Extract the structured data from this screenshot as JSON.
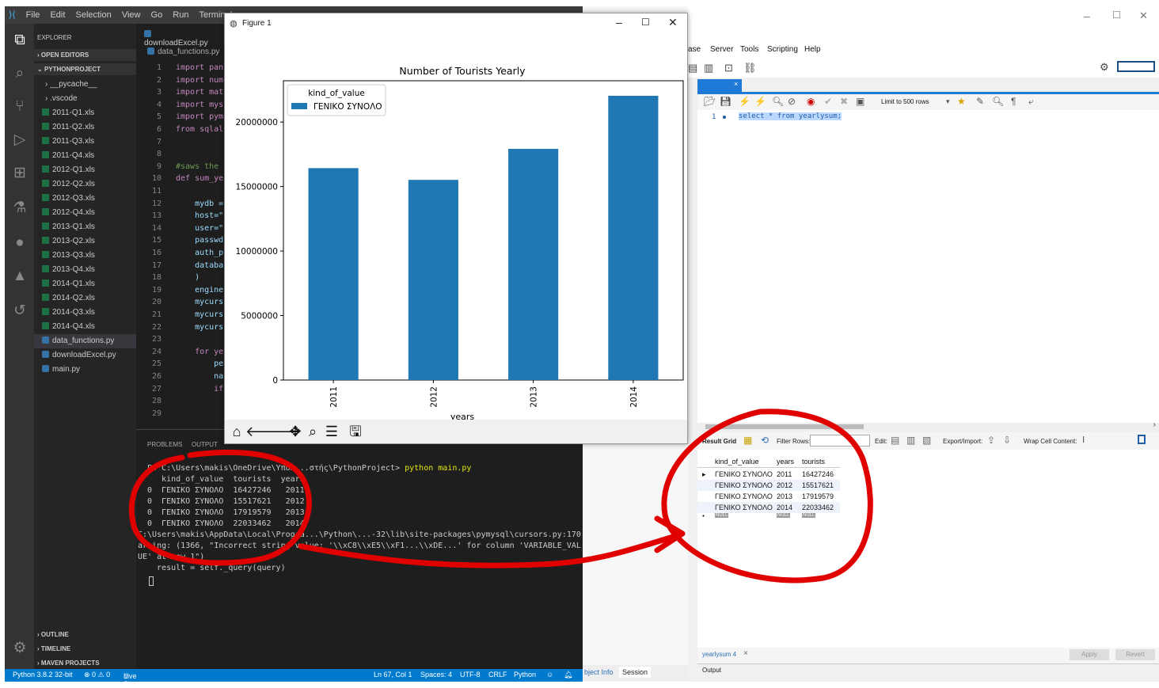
{
  "vscode": {
    "menu": [
      "File",
      "Edit",
      "Selection",
      "View",
      "Go",
      "Run",
      "Terminal"
    ],
    "explorer_title": "EXPLORER",
    "open_editors": "OPEN EDITORS",
    "project": "PYTHONPROJECT",
    "folders": [
      "__pycache__",
      ".vscode"
    ],
    "xls_files": [
      "2011-Q1.xls",
      "2011-Q2.xls",
      "2011-Q3.xls",
      "2011-Q4.xls",
      "2012-Q1.xls",
      "2012-Q2.xls",
      "2012-Q3.xls",
      "2012-Q4.xls",
      "2013-Q1.xls",
      "2013-Q2.xls",
      "2013-Q3.xls",
      "2013-Q4.xls",
      "2014-Q1.xls",
      "2014-Q2.xls",
      "2014-Q3.xls",
      "2014-Q4.xls"
    ],
    "py_files": [
      "data_functions.py",
      "downloadExcel.py",
      "main.py"
    ],
    "outline": "OUTLINE",
    "timeline": "TIMELINE",
    "maven": "MAVEN PROJECTS",
    "tab": "downloadExcel.py",
    "breadcrumb": "data_functions.py",
    "line_numbers": [
      "1",
      "2",
      "3",
      "4",
      "5",
      "6",
      "7",
      "8",
      "9",
      "10",
      "11",
      "12",
      "13",
      "14",
      "15",
      "16",
      "17",
      "18",
      "19",
      "20",
      "21",
      "22",
      "23",
      "24",
      "25",
      "26",
      "27",
      "28",
      "29"
    ],
    "code_lines": [
      "import pan",
      "import num",
      "import mat",
      "import mys",
      "import pym",
      "from sqlal",
      "",
      "",
      "#saws the",
      "def sum_ye",
      "",
      "    mydb =",
      "    host=\"",
      "    user=\"",
      "    passwd",
      "    auth_p",
      "    databa",
      "    )",
      "    engine",
      "    mycurs",
      "    mycurs",
      "    mycurs",
      "",
      "    for ye",
      "        pe",
      "        na",
      "        if",
      "",
      ""
    ],
    "panel_tabs": [
      "PROBLEMS",
      "OUTPUT"
    ],
    "terminal": [
      "PS C:\\Users\\makis\\OneDrive\\Υπολ...στής\\PythonProject> ",
      "   kind_of_value  tourists  years",
      "0  ΓΕΝΙΚΟ ΣΥΝΟΛΟ  16427246   2011",
      "0  ΓΕΝΙΚΟ ΣΥΝΟΛΟ  15517621   2012",
      "0  ΓΕΝΙΚΟ ΣΥΝΟΛΟ  17919579   2013",
      "0  ΓΕΝΙΚΟ ΣΥΝΟΛΟ  22033462   2014",
      "C:\\Users\\makis\\AppData\\Local\\Progra...\\Python\\...-32\\lib\\site-packages\\pymysql\\cursors.py:170: W",
      "arning: (1366, \"Incorrect string value: '\\\\xC8\\\\xE5\\\\xF1...\\\\xDE...' for column 'VARIABLE_VAL",
      "UE' at row 1\")",
      "  result = self._query(query)"
    ],
    "terminal_cmd": "python main.py",
    "status": {
      "python": "Python 3.8.2 32-bit",
      "problems": "⊗ 0 ⚠ 0",
      "liveshare": "Live Share",
      "pos": "Ln 67, Col 1",
      "spaces": "Spaces: 4",
      "enc": "UTF-8",
      "eol": "CRLF",
      "lang": "Python"
    }
  },
  "figure": {
    "window_title": "Figure 1"
  },
  "chart_data": {
    "type": "bar",
    "title": "Number of Tourists Yearly",
    "xlabel": "years",
    "ylabel": "",
    "categories": [
      "2011",
      "2012",
      "2013",
      "2014"
    ],
    "series": [
      {
        "name": "ΓΕΝΙΚΟ ΣΥΝΟΛΟ",
        "values": [
          16427246,
          15517621,
          17919579,
          22033462
        ]
      }
    ],
    "legend_title": "kind_of_value",
    "ylim": [
      0,
      23200000
    ],
    "yticks": [
      0,
      5000000,
      10000000,
      15000000,
      20000000
    ],
    "ytick_labels": [
      "0",
      "5000000",
      "10000000",
      "15000000",
      "20000000"
    ],
    "color": "#1f77b4",
    "legend": "top-left",
    "grid": false
  },
  "workbench": {
    "menu": [
      "ase",
      "Server",
      "Tools",
      "Scripting",
      "Help"
    ],
    "limit": "Limit to 500 rows",
    "query_num": "1",
    "query": "select * from yearlysum;",
    "result_grid": "Result Grid",
    "filter": "Filter Rows:",
    "edit": "Edit:",
    "export": "Export/Import:",
    "wrap": "Wrap Cell Content:",
    "headers": [
      "kind_of_value",
      "years",
      "tourists"
    ],
    "rows": [
      [
        "ΓΕΝΙΚΟ ΣΥΝΟΛΟ",
        "2011",
        "16427246"
      ],
      [
        "ΓΕΝΙΚΟ ΣΥΝΟΛΟ",
        "2012",
        "15517621"
      ],
      [
        "ΓΕΝΙΚΟ ΣΥΝΟΛΟ",
        "2013",
        "17919579"
      ],
      [
        "ΓΕΝΙΚΟ ΣΥΝΟΛΟ",
        "2014",
        "22033462"
      ]
    ],
    "null": "NULL",
    "result_tab": "yearlysum 4",
    "apply": "Apply",
    "revert": "Revert",
    "output": "Output",
    "object_info": "bject Info",
    "session": "Session"
  }
}
